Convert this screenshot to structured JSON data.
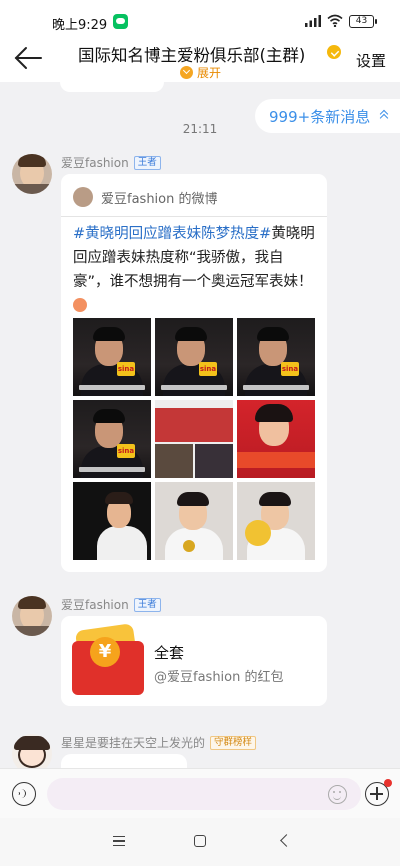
{
  "status_bar": {
    "time": "晚上9:29",
    "battery": "43"
  },
  "header": {
    "title": "国际知名博主爱粉俱乐部(主群)",
    "expand_label": "展开",
    "settings_label": "设置"
  },
  "chat": {
    "new_messages_label": "999+条新消息",
    "timestamp": "21:11",
    "messages": [
      {
        "sender": "爱豆fashion",
        "role": "王者",
        "card": {
          "source": "爱豆fashion 的微博",
          "topic": "#黄晓明回应蹭表妹陈梦热度#",
          "text": "黄晓明回应蹭表妹热度称“我骄傲，我自豪”，谁不想拥有一个奥运冠军表妹！",
          "photo_captions": [
            "sina",
            "sina",
            "sina",
            "sina"
          ]
        }
      },
      {
        "sender": "爱豆fashion",
        "role": "王者",
        "red_packet": {
          "title": "全套",
          "subtitle": "@爱豆fashion 的红包"
        }
      },
      {
        "sender": "星星是要挂在天空上发光的",
        "role": "守群榜样"
      }
    ]
  },
  "input": {
    "placeholder": ""
  },
  "icons": {
    "back": "back-arrow-icon",
    "voice": "voice-icon",
    "sticker": "sticker-icon",
    "plus": "plus-icon"
  },
  "colors": {
    "accent_blue": "#3b8fe8",
    "topic_blue": "#2a6fc7",
    "expand_orange": "#e88a00",
    "red_packet": "#e0302a",
    "notify_red": "#e8322d"
  }
}
